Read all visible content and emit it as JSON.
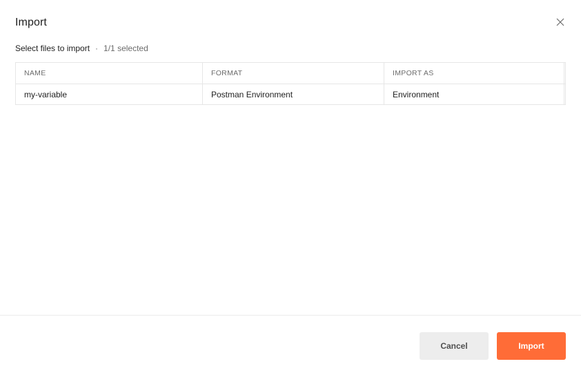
{
  "dialog": {
    "title": "Import",
    "subtitle": "Select files to import",
    "separator": "·",
    "selection_count": "1/1 selected"
  },
  "table": {
    "headers": [
      "NAME",
      "FORMAT",
      "IMPORT AS"
    ],
    "rows": [
      {
        "name": "my-variable",
        "format": "Postman Environment",
        "import_as": "Environment"
      }
    ]
  },
  "footer": {
    "cancel_label": "Cancel",
    "import_label": "Import"
  },
  "colors": {
    "accent": "#ff6c37",
    "cancel_bg": "#ededed",
    "border": "#e6e6e6"
  },
  "icons": {
    "close": "close-icon"
  }
}
